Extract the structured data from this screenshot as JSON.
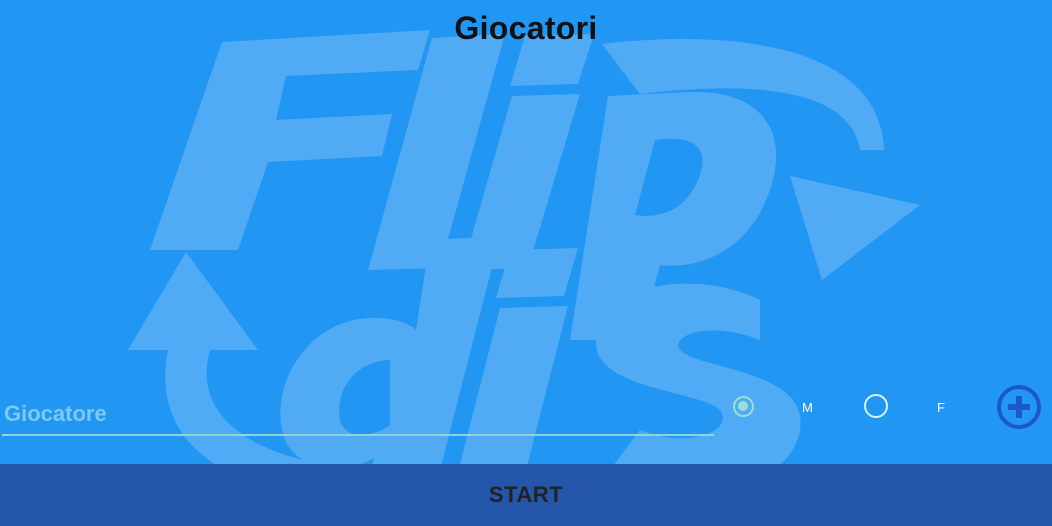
{
  "screen": {
    "title": "Giocatori",
    "logo_text": "Flip dis"
  },
  "form": {
    "player_placeholder": "Giocatore",
    "player_value": "",
    "gender_options": [
      {
        "label": "M",
        "selected": true
      },
      {
        "label": "F",
        "selected": false
      }
    ],
    "add_icon": "add-circle-icon"
  },
  "footer": {
    "start_label": "START"
  },
  "colors": {
    "background": "#2196F3",
    "start_bar": "#2356a8",
    "accent": "#1e57c8"
  }
}
